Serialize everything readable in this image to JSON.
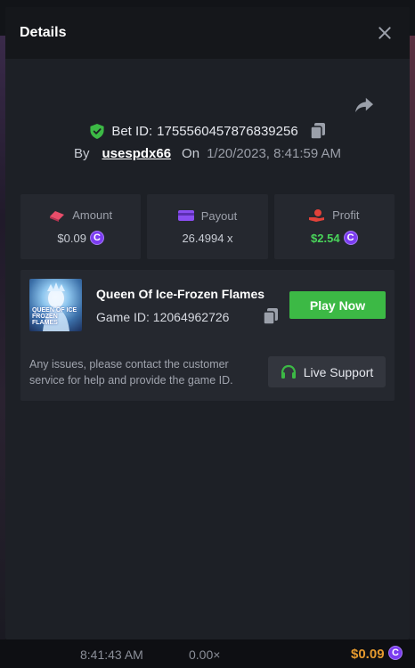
{
  "modal": {
    "title": "Details"
  },
  "bet": {
    "id_label": "Bet ID:",
    "id_value": "1755560457876839256",
    "by_label": "By",
    "username": "usespdx66",
    "on_label": "On",
    "datetime": "1/20/2023, 8:41:59 AM"
  },
  "stats": {
    "amount": {
      "label": "Amount",
      "value": "$0.09",
      "icon": "bet-icon",
      "color": "#e84d6a"
    },
    "payout": {
      "label": "Payout",
      "value": "26.4994 x",
      "icon": "card-icon",
      "color": "#8a4ef0"
    },
    "profit": {
      "label": "Profit",
      "value": "$2.54",
      "icon": "hand-coin-icon",
      "color": "#e2423a"
    }
  },
  "game": {
    "name": "Queen Of Ice-Frozen Flames",
    "id_label": "Game ID:",
    "id_value": "12064962726",
    "thumb_text_line1": "QUEEN OF ICE",
    "thumb_text_line2": "FROZEN FLAMES",
    "play_label": "Play Now"
  },
  "support": {
    "message": "Any issues, please contact the customer service for help and provide the game ID.",
    "button_label": "Live Support"
  },
  "background": {
    "time": "8:41:43 AM",
    "multiplier": "0.00×",
    "amount": "$0.09"
  },
  "colors": {
    "green": "#3cb945",
    "profit_green": "#49d45a",
    "coin_purple": "#7b3cf0",
    "bg_amount_orange": "#e69a2e"
  }
}
